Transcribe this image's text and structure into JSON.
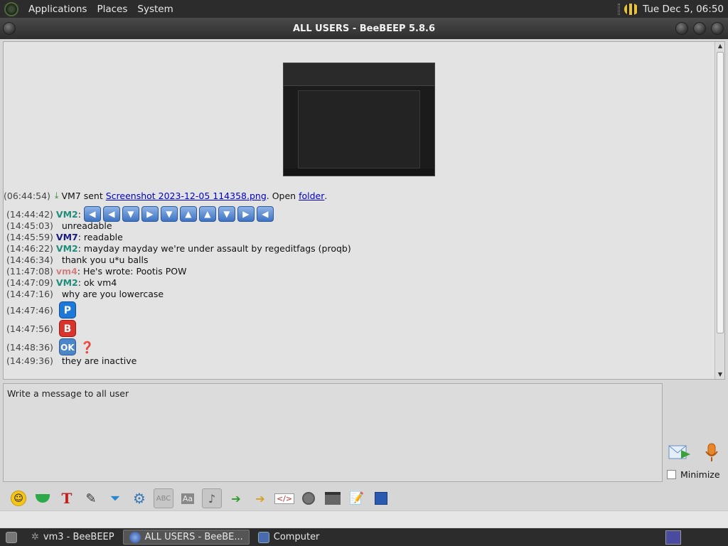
{
  "top_panel": {
    "menus": [
      "Applications",
      "Places",
      "System"
    ],
    "clock": "Tue Dec  5, 06:50"
  },
  "window": {
    "title": "ALL USERS - BeeBEEP 5.8.6"
  },
  "chat": {
    "file_message": {
      "time": "(06:44:54)",
      "sender_text": "VM7 sent",
      "file_link": "Screenshot 2023-12-05 114358.png",
      "open_text": ". Open",
      "folder_link": "folder",
      "end": "."
    },
    "messages": [
      {
        "time": "(14:44:42)",
        "user": "VM2",
        "user_class": "u-vm2",
        "text": ""
      },
      {
        "time": "(14:45:03)",
        "user": "",
        "user_class": "",
        "text": "unreadable"
      },
      {
        "time": "(14:45:59)",
        "user": "VM7",
        "user_class": "u-vm7",
        "text": "readable"
      },
      {
        "time": "(14:46:22)",
        "user": "VM2",
        "user_class": "u-vm2",
        "text": "mayday mayday we're under assault by regeditfags (proqb)"
      },
      {
        "time": "(14:46:34)",
        "user": "",
        "user_class": "",
        "text": "thank you u*u balls"
      },
      {
        "time": "(11:47:08)",
        "user": "vm4",
        "user_class": "u-vm4",
        "text": "He's wrote: Pootis POW"
      },
      {
        "time": "(14:47:09)",
        "user": "VM2",
        "user_class": "u-vm2",
        "text": "ok vm4"
      },
      {
        "time": "(14:47:16)",
        "user": "",
        "user_class": "",
        "text": "why are you lowercase"
      },
      {
        "time": "(14:47:46)",
        "emoji": "P"
      },
      {
        "time": "(14:47:56)",
        "emoji": "B"
      },
      {
        "time": "(14:48:36)",
        "emoji": "OK",
        "extra": "❓"
      },
      {
        "time": "(14:49:36)",
        "user": "",
        "user_class": "",
        "text": "they are inactive"
      }
    ],
    "arrow_sequence": [
      "◀",
      "◀",
      "▼",
      "▶",
      "▼",
      "▲",
      "▲",
      "▼",
      "▶",
      "◀"
    ]
  },
  "input": {
    "placeholder": "Write a message to all user"
  },
  "send_panel": {
    "minimize_label": "Minimize"
  },
  "toolbar": {
    "icons": [
      "smiley-icon",
      "download-tray-icon",
      "text-format-icon",
      "color-pen-icon",
      "filter-icon",
      "settings-gear-icon",
      "spellcheck-icon",
      "font-icon",
      "music-note-icon",
      "send-file-icon",
      "send-folder-icon",
      "code-icon",
      "record-icon",
      "screenshot-icon",
      "note-icon",
      "save-icon"
    ]
  },
  "taskbar": {
    "tasks": [
      {
        "label": "vm3 - BeeBEEP",
        "active": false
      },
      {
        "label": "ALL USERS - BeeBE...",
        "active": true
      },
      {
        "label": "Computer",
        "active": false
      }
    ]
  }
}
